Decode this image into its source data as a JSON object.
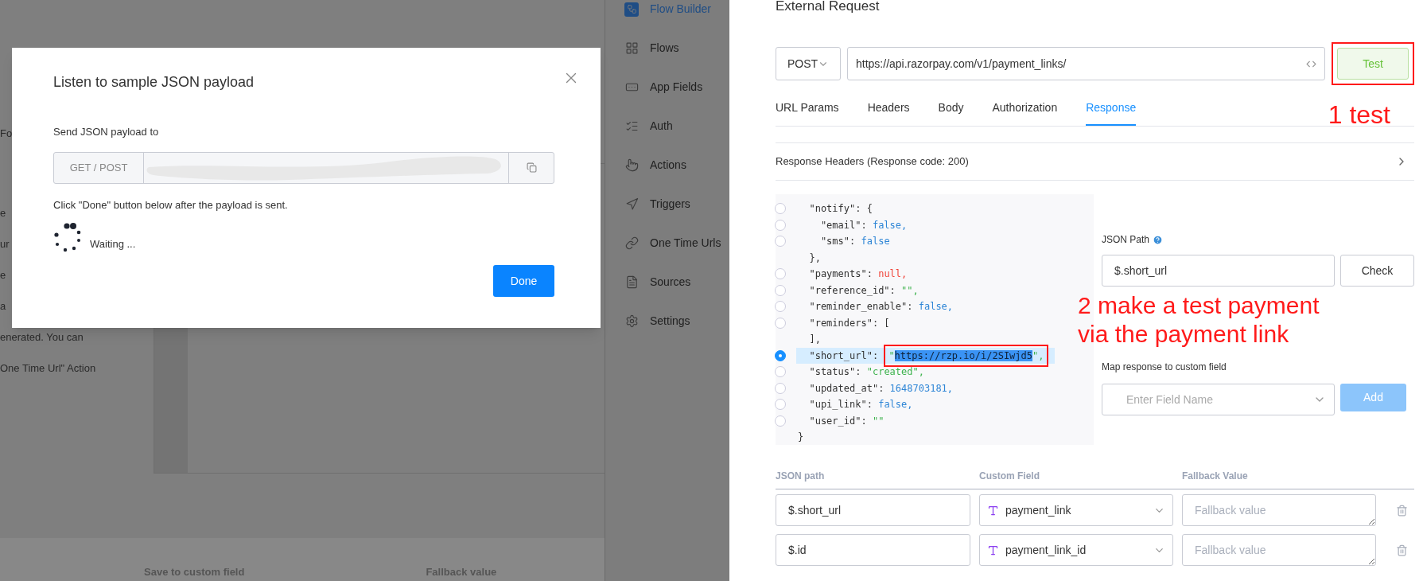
{
  "background": {
    "fragments": [
      "Fo",
      "e",
      "ur",
      "e",
      "a"
    ],
    "lines": [
      "enerated. You can",
      "One Time Url\" Action"
    ],
    "table_headers": [
      "Save to custom field",
      "Fallback value"
    ]
  },
  "dialog": {
    "title": "Listen to sample JSON payload",
    "send_label": "Send JSON payload to",
    "method_addon": "GET / POST",
    "hint": "Click \"Done\" button below after the payload is sent.",
    "waiting": "Waiting ...",
    "done_button": "Done"
  },
  "sidebar": {
    "items": [
      {
        "label": "Flow Builder",
        "selected": true
      },
      {
        "label": "Flows",
        "selected": false
      },
      {
        "label": "App Fields",
        "selected": false
      },
      {
        "label": "Auth",
        "selected": false
      },
      {
        "label": "Actions",
        "selected": false
      },
      {
        "label": "Triggers",
        "selected": false
      },
      {
        "label": "One Time Urls",
        "selected": false
      },
      {
        "label": "Sources",
        "selected": false
      },
      {
        "label": "Settings",
        "selected": false
      }
    ]
  },
  "request": {
    "title": "External Request",
    "method": "POST",
    "url": "https://api.razorpay.com/v1/payment_links/",
    "test_button": "Test",
    "tabs": [
      {
        "label": "URL Params",
        "selected": false
      },
      {
        "label": "Headers",
        "selected": false
      },
      {
        "label": "Body",
        "selected": false
      },
      {
        "label": "Authorization",
        "selected": false
      },
      {
        "label": "Response",
        "selected": true
      }
    ],
    "response_headers": "Response Headers (Response code: 200)",
    "code_lines": [
      {
        "kind": "field",
        "selected": false,
        "segments": [
          {
            "text": "  \"notify\": {",
            "kind": "plain"
          }
        ]
      },
      {
        "kind": "field",
        "selected": false,
        "segments": [
          {
            "text": "    \"email\": ",
            "kind": "plain"
          },
          {
            "text": "false,",
            "kind": "bool"
          }
        ]
      },
      {
        "kind": "field",
        "selected": false,
        "segments": [
          {
            "text": "    \"sms\": ",
            "kind": "plain"
          },
          {
            "text": "false",
            "kind": "bool"
          }
        ]
      },
      {
        "kind": "bracket",
        "segments": [
          {
            "text": "  },",
            "kind": "plain"
          }
        ]
      },
      {
        "kind": "field",
        "selected": false,
        "segments": [
          {
            "text": "  \"payments\": ",
            "kind": "plain"
          },
          {
            "text": "null,",
            "kind": "null"
          }
        ]
      },
      {
        "kind": "field",
        "selected": false,
        "segments": [
          {
            "text": "  \"reference_id\": ",
            "kind": "plain"
          },
          {
            "text": "\"\",",
            "kind": "string"
          }
        ]
      },
      {
        "kind": "field",
        "selected": false,
        "segments": [
          {
            "text": "  \"reminder_enable\": ",
            "kind": "plain"
          },
          {
            "text": "false,",
            "kind": "bool"
          }
        ]
      },
      {
        "kind": "field",
        "selected": false,
        "segments": [
          {
            "text": "  \"reminders\": [",
            "kind": "plain"
          }
        ]
      },
      {
        "kind": "bracket",
        "segments": [
          {
            "text": "  ],",
            "kind": "plain"
          }
        ]
      },
      {
        "kind": "field",
        "selected": true,
        "segments": [
          {
            "text": "  \"short_url\": ",
            "kind": "plain"
          },
          {
            "text": "\"",
            "kind": "string",
            "boxed": true
          },
          {
            "text": "https://rzp.io/i/2SIwjd5",
            "kind": "highlight",
            "boxed": true
          },
          {
            "text": "\",",
            "kind": "string",
            "boxed": true
          }
        ]
      },
      {
        "kind": "field",
        "selected": false,
        "segments": [
          {
            "text": "  \"status\": ",
            "kind": "plain"
          },
          {
            "text": "\"created\",",
            "kind": "string"
          }
        ]
      },
      {
        "kind": "field",
        "selected": false,
        "segments": [
          {
            "text": "  \"updated_at\": ",
            "kind": "plain"
          },
          {
            "text": "1648703181,",
            "kind": "number"
          }
        ]
      },
      {
        "kind": "field",
        "selected": false,
        "segments": [
          {
            "text": "  \"upi_link\": ",
            "kind": "plain"
          },
          {
            "text": "false,",
            "kind": "bool"
          }
        ]
      },
      {
        "kind": "field",
        "selected": false,
        "segments": [
          {
            "text": "  \"user_id\": ",
            "kind": "plain"
          },
          {
            "text": "\"\"",
            "kind": "string"
          }
        ]
      },
      {
        "kind": "bracket",
        "segments": [
          {
            "text": "}",
            "kind": "plain"
          }
        ]
      }
    ],
    "json_path_label": "JSON Path",
    "json_path_value": "$.short_url",
    "check_button": "Check",
    "map_label": "Map response to custom field",
    "field_placeholder": "Enter Field Name",
    "add_button": {
      "label": "Add",
      "disabled": true
    },
    "columns": [
      "JSON path",
      "Custom Field",
      "Fallback Value"
    ],
    "rows": [
      {
        "path": "$.short_url",
        "field": "payment_link",
        "fallback_placeholder": "Fallback value"
      },
      {
        "path": "$.id",
        "field": "payment_link_id",
        "fallback_placeholder": "Fallback value"
      }
    ]
  },
  "annotations": [
    "1 test",
    "2 make a test payment via the payment link"
  ]
}
